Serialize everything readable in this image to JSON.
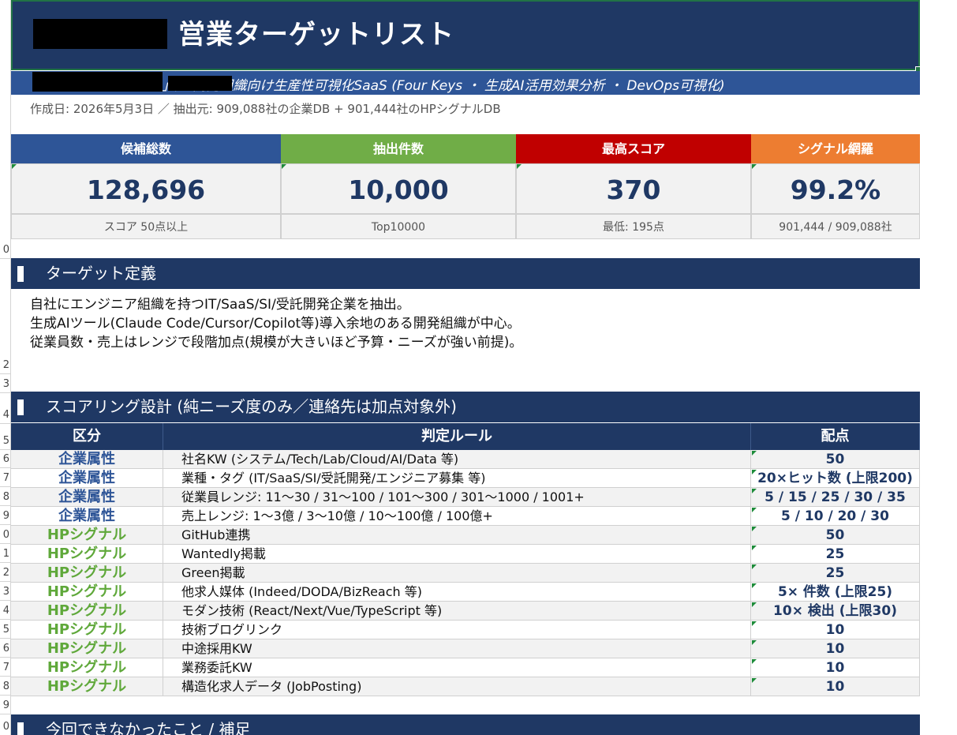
{
  "header": {
    "title": "営業ターゲットリスト",
    "subtitle": "」／ 開発組織向け生産性可視化SaaS (Four Keys ・ 生成AI活用効果分析 ・ DevOps可視化)",
    "meta": "作成日: 2026年5月3日 ／ 抽出元: 909,088社の企業DB + 901,444社のHPシグナルDB"
  },
  "kpis": [
    {
      "label": "候補総数",
      "value": "128,696",
      "note": "スコア 50点以上",
      "color": "#2e5597"
    },
    {
      "label": "抽出件数",
      "value": "10,000",
      "note": "Top10000",
      "color": "#70ad47"
    },
    {
      "label": "最高スコア",
      "value": "370",
      "note": "最低: 195点",
      "color": "#c00000"
    },
    {
      "label": "シグナル網羅",
      "value": "99.2%",
      "note": "901,444 / 909,088社",
      "color": "#ed7d31"
    }
  ],
  "target_section": {
    "title": "ターゲット定義",
    "lines": [
      "自社にエンジニア組織を持つIT/SaaS/SI/受託開発企業を抽出。",
      "生成AIツール(Claude Code/Cursor/Copilot等)導入余地のある開発組織が中心。",
      "従業員数・売上はレンジで段階加点(規模が大きいほど予算・ニーズが強い前提)。"
    ]
  },
  "scoring_section": {
    "title": "スコアリング設計 (純ニーズ度のみ／連絡先は加点対象外)",
    "headers": [
      "区分",
      "判定ルール",
      "配点"
    ],
    "rows": [
      {
        "category": "企業属性",
        "rule": "社名KW (システム/Tech/Lab/Cloud/AI/Data 等)",
        "points": "50"
      },
      {
        "category": "企業属性",
        "rule": "業種・タグ (IT/SaaS/SI/受託開発/エンジニア募集 等)",
        "points": "20×ヒット数 (上限200)"
      },
      {
        "category": "企業属性",
        "rule": "従業員レンジ: 11〜30 / 31〜100 / 101〜300 / 301〜1000 / 1001+",
        "points": "5 / 15 / 25 / 30 / 35"
      },
      {
        "category": "企業属性",
        "rule": "売上レンジ: 1〜3億 / 3〜10億 / 10〜100億 / 100億+",
        "points": "5 / 10 / 20 / 30"
      },
      {
        "category": "HPシグナル",
        "rule": "GitHub連携",
        "points": "50"
      },
      {
        "category": "HPシグナル",
        "rule": "Wantedly掲載",
        "points": "25"
      },
      {
        "category": "HPシグナル",
        "rule": "Green掲載",
        "points": "25"
      },
      {
        "category": "HPシグナル",
        "rule": "他求人媒体 (Indeed/DODA/BizReach 等)",
        "points": "5× 件数 (上限25)"
      },
      {
        "category": "HPシグナル",
        "rule": "モダン技術 (React/Next/Vue/TypeScript 等)",
        "points": "10× 検出 (上限30)"
      },
      {
        "category": "HPシグナル",
        "rule": "技術ブログリンク",
        "points": "10"
      },
      {
        "category": "HPシグナル",
        "rule": "中途採用KW",
        "points": "10"
      },
      {
        "category": "HPシグナル",
        "rule": "業務委託KW",
        "points": "10"
      },
      {
        "category": "HPシグナル",
        "rule": "構造化求人データ (JobPosting)",
        "points": "10"
      }
    ]
  },
  "notes_section": {
    "title": "今回できなかったこと / 補足"
  },
  "row_numbers": [
    "0",
    "2",
    "3",
    "4",
    "5",
    "6",
    "7",
    "8",
    "9",
    "0",
    "1",
    "2",
    "3",
    "4",
    "5",
    "6",
    "7",
    "8",
    "9",
    "0"
  ],
  "colors": {
    "navy": "#1f3864",
    "blue": "#2e5597",
    "attr_category": "#2e5597",
    "signal_category": "#5fa83a"
  }
}
